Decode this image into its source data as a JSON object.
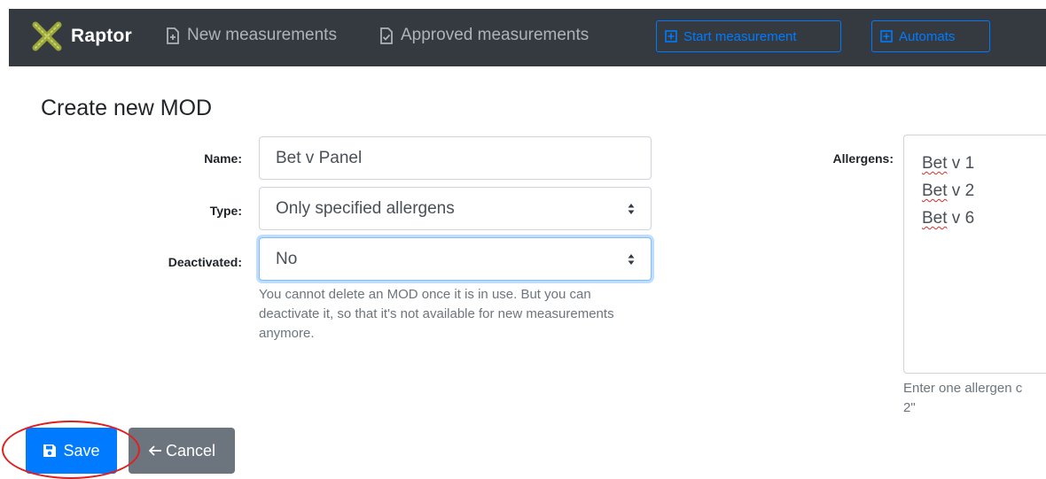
{
  "navbar": {
    "brand": "Raptor",
    "links": [
      {
        "label": "New measurements",
        "icon": "file-plus-icon"
      },
      {
        "label": "Approved measurements",
        "icon": "file-check-icon"
      }
    ],
    "buttons": [
      {
        "label": "Start measurement",
        "icon": "plus-square-icon"
      },
      {
        "label": "Automats",
        "icon": "plus-square-icon"
      }
    ],
    "colors": {
      "background": "#343a40",
      "link": "#aeb3b8",
      "accent": "#007bff"
    }
  },
  "page": {
    "title": "Create new MOD"
  },
  "form": {
    "name": {
      "label": "Name:",
      "value": "Bet v Panel"
    },
    "type": {
      "label": "Type:",
      "value": "Only specified allergens"
    },
    "deactivated": {
      "label": "Deactivated:",
      "value": "No",
      "help": "You cannot delete an MOD once it is in use. But you can deactivate it, so that it's not available for new measurements anymore."
    },
    "allergens": {
      "label": "Allergens:",
      "lines": [
        {
          "word": "Bet",
          "rest": " v 1"
        },
        {
          "word": "Bet",
          "rest": " v 2"
        },
        {
          "word": "Bet",
          "rest": " v 6"
        }
      ],
      "help_line1": "Enter one allergen c",
      "help_line2": "2\""
    }
  },
  "actions": {
    "save_label": "Save",
    "cancel_label": "Cancel",
    "colors": {
      "save": "#007bff",
      "cancel": "#6c757d",
      "highlight": "#e02020"
    }
  }
}
